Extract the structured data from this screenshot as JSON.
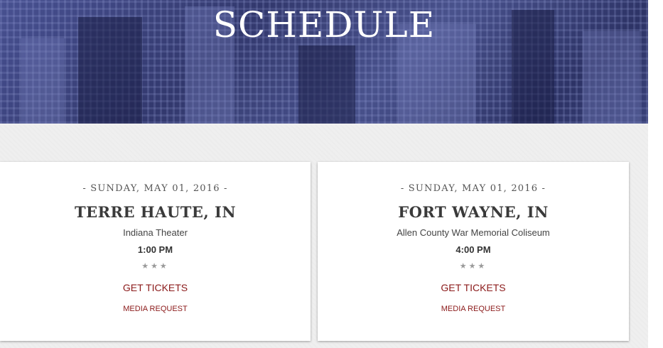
{
  "header": {
    "title": "SCHEDULE"
  },
  "events": [
    {
      "date": "- SUNDAY, MAY 01, 2016 -",
      "city": "TERRE HAUTE, IN",
      "venue": "Indiana Theater",
      "time": "1:00 PM",
      "stars": "★★★",
      "tickets_label": "GET TICKETS",
      "media_label": "MEDIA REQUEST"
    },
    {
      "date": "- SUNDAY, MAY 01, 2016 -",
      "city": "FORT WAYNE, IN",
      "venue": "Allen County War Memorial Coliseum",
      "time": "4:00 PM",
      "stars": "★★★",
      "tickets_label": "GET TICKETS",
      "media_label": "MEDIA REQUEST"
    }
  ],
  "colors": {
    "hero": "#2c3364",
    "link": "#8b1a1a"
  }
}
